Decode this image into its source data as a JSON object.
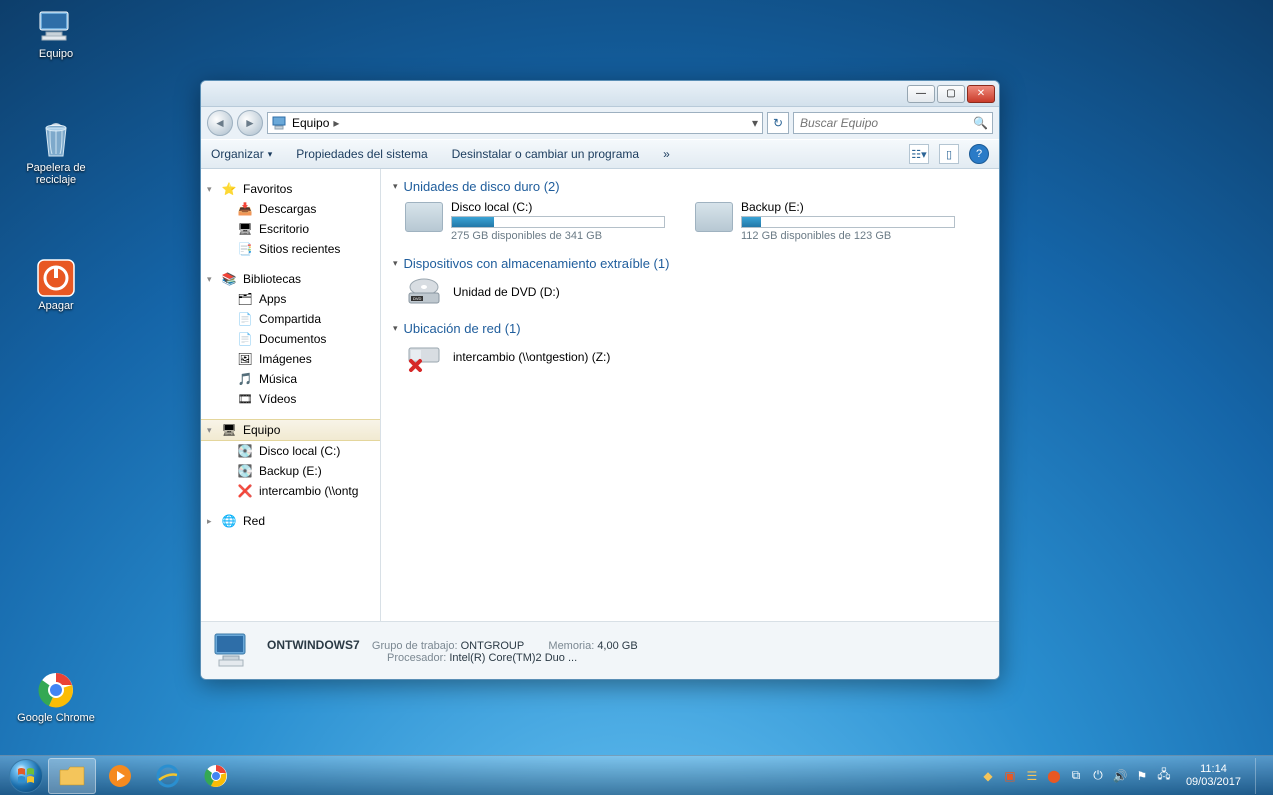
{
  "desktop": {
    "icons": [
      {
        "label": "Equipo",
        "kind": "computer"
      },
      {
        "label": "Papelera de\nreciclaje",
        "kind": "recycle"
      },
      {
        "label": "Apagar",
        "kind": "shutdown"
      },
      {
        "label": "Google Chrome",
        "kind": "chrome"
      }
    ]
  },
  "window": {
    "title_buttons": {
      "min": "—",
      "max": "▢",
      "close": "✕"
    },
    "breadcrumb": {
      "root_icon": "computer",
      "root": "Equipo",
      "arrow": "▸"
    },
    "search_placeholder": "Buscar Equipo",
    "toolbar": {
      "organize": "Organizar",
      "props": "Propiedades del sistema",
      "uninstall": "Desinstalar o cambiar un programa",
      "more": "»"
    },
    "sidebar": {
      "favorites": {
        "label": "Favoritos",
        "items": [
          {
            "ico": "downloads",
            "label": "Descargas"
          },
          {
            "ico": "desktop",
            "label": "Escritorio"
          },
          {
            "ico": "recent",
            "label": "Sitios recientes"
          }
        ]
      },
      "libraries": {
        "label": "Bibliotecas",
        "items": [
          {
            "ico": "apps",
            "label": "Apps"
          },
          {
            "ico": "shared",
            "label": "Compartida"
          },
          {
            "ico": "docs",
            "label": "Documentos"
          },
          {
            "ico": "pictures",
            "label": "Imágenes"
          },
          {
            "ico": "music",
            "label": "Música"
          },
          {
            "ico": "videos",
            "label": "Vídeos"
          }
        ]
      },
      "computer": {
        "label": "Equipo",
        "items": [
          {
            "ico": "hdd",
            "label": "Disco local (C:)"
          },
          {
            "ico": "hdd",
            "label": "Backup (E:)"
          },
          {
            "ico": "netx",
            "label": "intercambio (\\\\ontg"
          }
        ]
      },
      "network": {
        "label": "Red"
      }
    },
    "main": {
      "hdd_section": "Unidades de disco duro (2)",
      "drives": [
        {
          "name": "Disco local (C:)",
          "fill_pct": 20,
          "sub": "275 GB disponibles de 341 GB"
        },
        {
          "name": "Backup (E:)",
          "fill_pct": 9,
          "sub": "112 GB disponibles de 123 GB"
        }
      ],
      "removable_section": "Dispositivos con almacenamiento extraíble (1)",
      "removable": [
        {
          "name": "Unidad de DVD (D:)"
        }
      ],
      "network_section": "Ubicación de red (1)",
      "network": [
        {
          "name": "intercambio (\\\\ontgestion) (Z:)"
        }
      ]
    },
    "details": {
      "name": "ONTWINDOWS7",
      "grupo_lbl": "Grupo de trabajo:",
      "grupo_val": "ONTGROUP",
      "mem_lbl": "Memoria:",
      "mem_val": "4,00 GB",
      "proc_lbl": "Procesador:",
      "proc_val": "Intel(R) Core(TM)2 Duo ..."
    }
  },
  "taskbar": {
    "time": "11:14",
    "date": "09/03/2017"
  }
}
